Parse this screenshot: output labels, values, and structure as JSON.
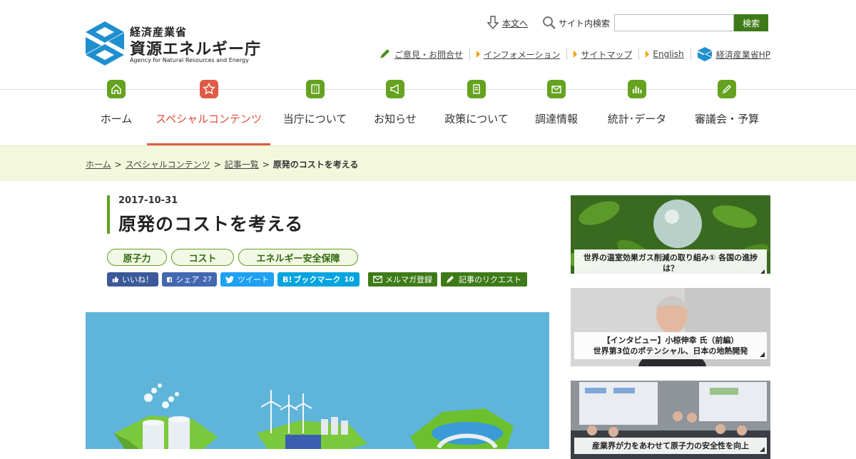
{
  "logo": {
    "ministry": "経済産業省",
    "agency": "資源エネルギー庁",
    "agency_en": "Agency for Natural Resources and Energy"
  },
  "header": {
    "skip_link": "本文へ",
    "search_label": "サイト内検索",
    "search_value": "",
    "search_button": "検索",
    "links": [
      {
        "label": "ご意見・お問合せ"
      },
      {
        "label": "インフォメーション"
      },
      {
        "label": "サイトマップ"
      },
      {
        "label": "English"
      },
      {
        "label": "経済産業省HP"
      }
    ]
  },
  "nav": {
    "items": [
      {
        "label": "ホーム"
      },
      {
        "label": "スペシャルコンテンツ"
      },
      {
        "label": "当庁について"
      },
      {
        "label": "お知らせ"
      },
      {
        "label": "政策について"
      },
      {
        "label": "調達情報"
      },
      {
        "label": "統計･データ"
      },
      {
        "label": "審議会・予算"
      }
    ],
    "active_index": 1
  },
  "breadcrumb": {
    "items": [
      "ホーム",
      "スペシャルコンテンツ",
      "記事一覧"
    ],
    "sep": ">",
    "current": "原発のコストを考える"
  },
  "article": {
    "date": "2017-10-31",
    "title": "原発のコストを考える",
    "tags": [
      "原子力",
      "コスト",
      "エネルギー安全保障"
    ]
  },
  "share": {
    "like": "いいね！",
    "share": "シェア",
    "share_count": "27",
    "tweet": "ツイート",
    "bookmark": "ブックマーク",
    "bookmark_prefix": "B!",
    "bookmark_count": "10",
    "mail": "メルマガ登録",
    "request": "記事のリクエスト"
  },
  "sidebar": {
    "cards": [
      {
        "caption": "世界の温室効果ガス削減の取り組み① 各国の進捗は？"
      },
      {
        "caption_line1": "【インタビュー】小椋伸幸 氏（前編）",
        "caption_line2": "世界第3位のポテンシャル、日本の地熱開発"
      },
      {
        "caption": "産業界が力をあわせて原子力の安全性を向上"
      }
    ]
  },
  "colors": {
    "brand_green": "#5ea11f",
    "button_green": "#3e7b18",
    "accent_red": "#e05a45",
    "logo_blue": "#1e8fcf",
    "breadcrumb_bg": "#f3f8dc"
  }
}
